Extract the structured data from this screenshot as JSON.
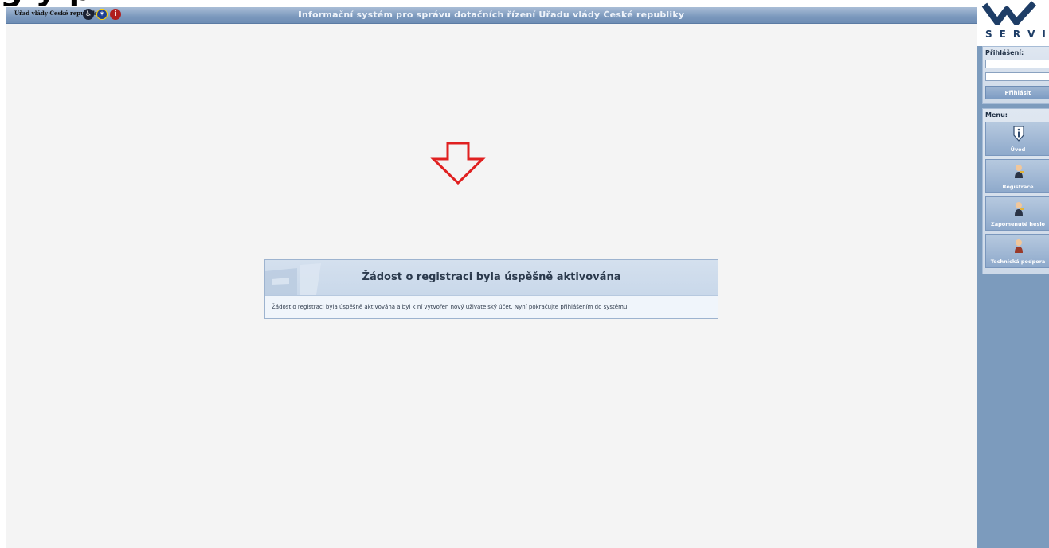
{
  "page_heading_fragment": "g      y   p",
  "header": {
    "brand": "Úřad vlády České republiky",
    "title": "Informační systém pro správu dotačních řízení Úřadu vlády České republiky",
    "icons": [
      "accessibility-icon",
      "eu-flag-icon",
      "info-icon"
    ]
  },
  "notice": {
    "title": "Žádost o registraci byla úspěšně aktivována",
    "message": "Žádost o registraci byla úspěšně aktivována a byl k ní vytvořen nový uživatelský účet. Nyní pokračujte přihlášením do systému."
  },
  "sidebar": {
    "logo_text": "SERVIS",
    "login": {
      "label": "Přihlášení:",
      "username_value": "",
      "password_value": "",
      "button": "Přihlásit"
    },
    "menu": {
      "label": "Menu:",
      "items": [
        {
          "label": "Úvod",
          "icon": "info-shield-icon"
        },
        {
          "label": "Registrace",
          "icon": "user-key-icon"
        },
        {
          "label": "Zapomenuté heslo",
          "icon": "user-key-icon"
        },
        {
          "label": "Technická podpora",
          "icon": "support-person-icon"
        }
      ]
    }
  },
  "colors": {
    "header_bar": "#7b98bd",
    "sidebar_bg": "#7c9bbd",
    "arrow": "#e02020",
    "panel_head": "#c9d8ea"
  }
}
